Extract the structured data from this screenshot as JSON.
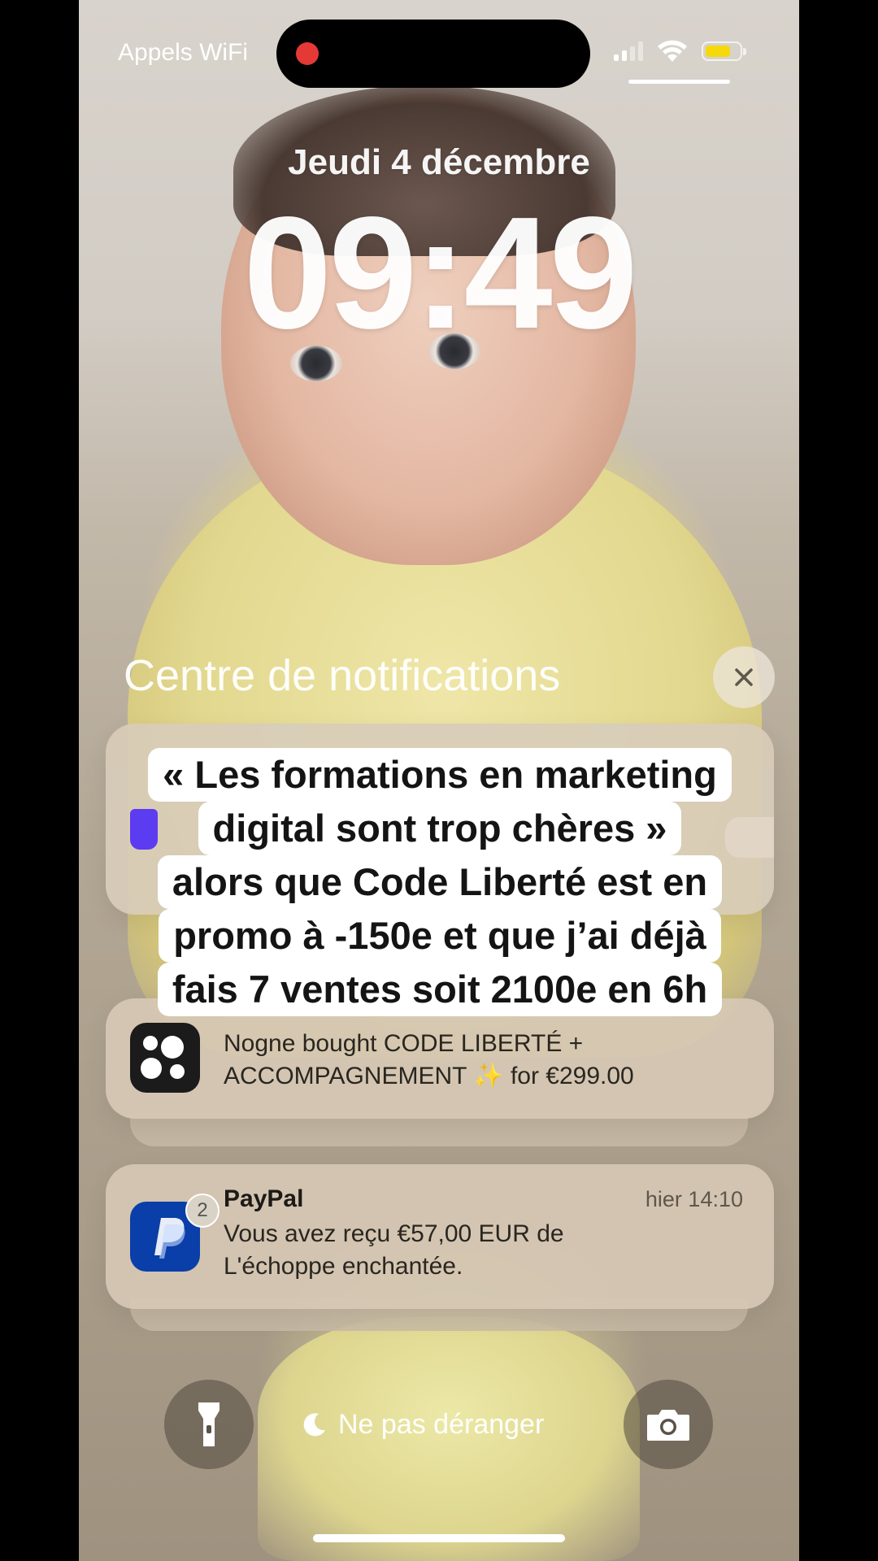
{
  "status_bar": {
    "carrier": "Appels WiFi",
    "recording": true,
    "battery_color": "#f5d90a",
    "battery_level": 0.75,
    "signal_bars_active": 2
  },
  "lock_screen": {
    "date": "Jeudi 4 décembre",
    "time": "09:49"
  },
  "notification_center": {
    "title": "Centre de notifications"
  },
  "caption": {
    "lines": [
      "« Les formations en marketing",
      "digital sont trop chères »",
      "alors que Code Liberté est en",
      "promo à -150e et que j’ai déjà",
      "fais 7 ventes soit 2100e en 6h"
    ]
  },
  "notifications": [
    {
      "icon": "shopify-style-app-icon",
      "text_line1": "Nogne bought CODE LIBERTÉ +",
      "text_line2": "ACCOMPAGNEMENT ✨ for €299.00"
    },
    {
      "app": "PayPal",
      "icon": "paypal-icon",
      "time": "hier 14:10",
      "badge": "2",
      "text_line1": "Vous avez reçu €57,00 EUR de",
      "text_line2": "L'échoppe enchantée."
    }
  ],
  "bottom_controls": {
    "flashlight_icon": "flashlight-icon",
    "focus_label": "Ne pas déranger",
    "camera_icon": "camera-icon"
  },
  "colors": {
    "paypal_blue": "#0a3ea8",
    "accent_purple": "#5b3cf0"
  }
}
